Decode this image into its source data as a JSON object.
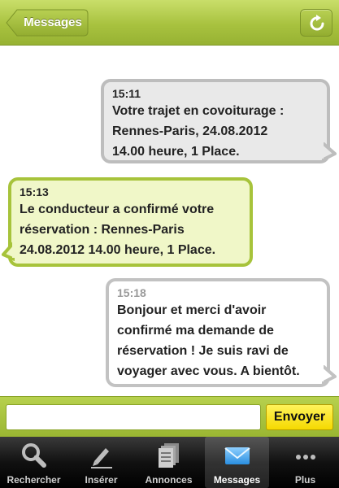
{
  "navbar": {
    "back_label": "Messages",
    "refresh_icon": "refresh-icon"
  },
  "thread": {
    "messages": [
      {
        "direction": "outgoing",
        "time": "15:11",
        "lines": [
          "Votre trajet en covoiturage :",
          "Rennes-Paris, 24.08.2012",
          "14.00 heure, 1 Place."
        ]
      },
      {
        "direction": "incoming",
        "time": "15:13",
        "lines": [
          "Le conducteur a confirmé votre",
          "réservation : Rennes-Paris",
          "24.08.2012 14.00 heure, 1 Place."
        ]
      },
      {
        "direction": "outgoing",
        "time": "15:18",
        "lines": [
          "Bonjour et merci d'avoir",
          "confirmé ma demande de",
          "réservation ! Je suis ravi de",
          "voyager avec vous. A bientôt."
        ]
      }
    ]
  },
  "compose": {
    "input_value": "",
    "input_placeholder": "",
    "send_label": "Envoyer"
  },
  "tabbar": {
    "tabs": [
      {
        "label": "Rechercher",
        "icon": "search-icon",
        "active": false
      },
      {
        "label": "Insérer",
        "icon": "pencil-icon",
        "active": false
      },
      {
        "label": "Annonces",
        "icon": "documents-icon",
        "active": false
      },
      {
        "label": "Messages",
        "icon": "envelope-icon",
        "active": true
      },
      {
        "label": "Plus",
        "icon": "more-dots-icon",
        "active": false
      }
    ]
  },
  "colors": {
    "brand_green": "#a8c23f",
    "incoming_bubble": "#f0f7c8",
    "outgoing_bubble": "#e9e9e9",
    "send_button": "#f5d900",
    "tabbar": "#111111"
  }
}
